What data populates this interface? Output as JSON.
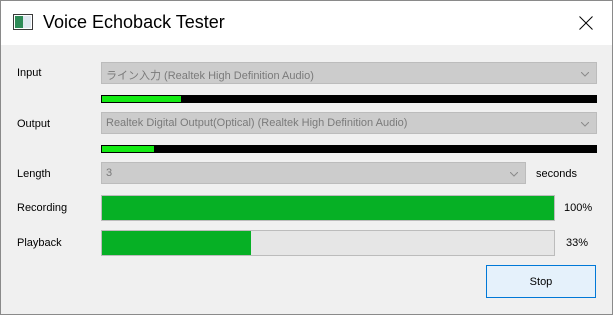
{
  "window": {
    "title": "Voice Echoback Tester",
    "icon": "app-window-icon",
    "close_icon": "close-icon"
  },
  "input": {
    "label": "Input",
    "selected_device": "ライン入力 (Realtek High Definition Audio)",
    "level": 0.16
  },
  "output": {
    "label": "Output",
    "selected_device": "Realtek Digital Output(Optical) (Realtek High Definition Audio)",
    "level": 0.105
  },
  "length": {
    "label": "Length",
    "value": "3",
    "unit": "seconds"
  },
  "recording": {
    "label": "Recording",
    "percent_text": "100%",
    "progress": 1.0
  },
  "playback": {
    "label": "Playback",
    "percent_text": "33%",
    "progress": 0.33
  },
  "actions": {
    "stop_label": "Stop"
  },
  "colors": {
    "meter_fill": "#13ea13",
    "meter_track": "#000000",
    "progress_fill": "#06b025",
    "button_border": "#0078d7"
  }
}
